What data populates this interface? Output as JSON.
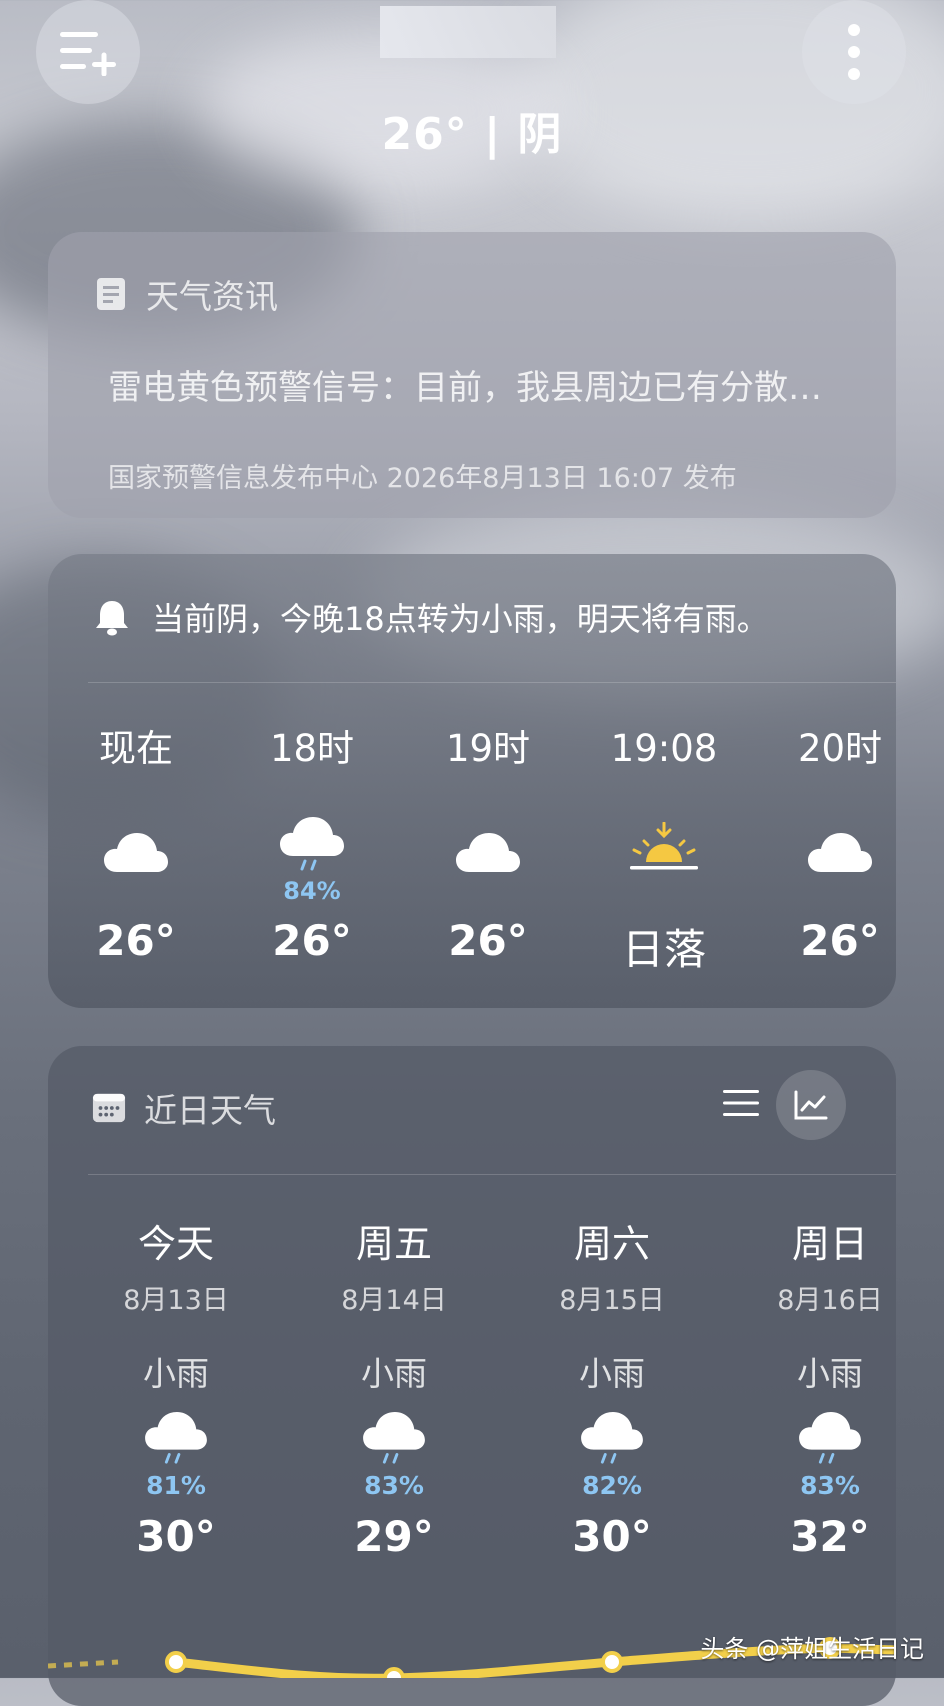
{
  "header": {
    "city_name": "",
    "temp_condition": "26° | 阴"
  },
  "news": {
    "title": "天气资讯",
    "body": "雷电黄色预警信号：目前，我县周边已有分散…",
    "source": "国家预警信息发布中心 2026年8月13日 16:07 发布"
  },
  "hourly": {
    "alert": "当前阴，今晚18点转为小雨，明天将有雨。",
    "items": [
      {
        "label": "现在",
        "icon": "cloud-icon",
        "prob": "",
        "temp": "26°"
      },
      {
        "label": "18时",
        "icon": "rain-cloud-icon",
        "prob": "84%",
        "temp": "26°"
      },
      {
        "label": "19时",
        "icon": "cloud-icon",
        "prob": "",
        "temp": "26°"
      },
      {
        "label": "19:08",
        "icon": "sunset-icon",
        "prob": "",
        "temp": "日落"
      },
      {
        "label": "20时",
        "icon": "cloud-icon",
        "prob": "",
        "temp": "26°"
      }
    ]
  },
  "daily": {
    "title": "近日天气",
    "days": [
      {
        "name": "今天",
        "date": "8月13日",
        "cond": "小雨",
        "prob": "81%",
        "temp": "30°"
      },
      {
        "name": "周五",
        "date": "8月14日",
        "cond": "小雨",
        "prob": "83%",
        "temp": "29°"
      },
      {
        "name": "周六",
        "date": "8月15日",
        "cond": "小雨",
        "prob": "82%",
        "temp": "30°"
      },
      {
        "name": "周日",
        "date": "8月16日",
        "cond": "小雨",
        "prob": "83%",
        "temp": "32°"
      }
    ]
  },
  "colors": {
    "rain_prob": "#8ec6f2",
    "sun_yellow": "#f5c842",
    "trend_line": "#f2cf4a"
  },
  "watermark": "头条 @萍姐生活日记"
}
